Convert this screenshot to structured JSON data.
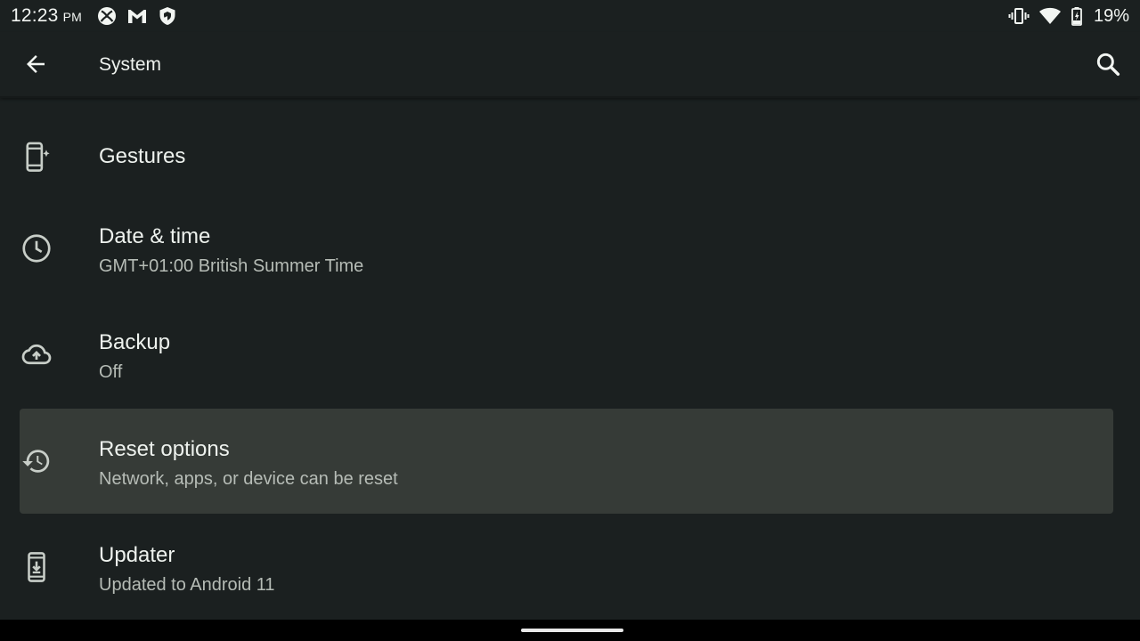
{
  "status_bar": {
    "time": "12:23",
    "ampm": "PM",
    "notification_icons": [
      "xbox-icon",
      "gmail-icon",
      "shield-icon"
    ],
    "system_icons": [
      "vibrate-icon",
      "wifi-icon",
      "battery-icon"
    ],
    "battery_percent": "19%"
  },
  "toolbar": {
    "title": "System",
    "back_icon": "arrow-back-icon",
    "search_icon": "search-icon"
  },
  "settings": {
    "items": [
      {
        "icon": "gestures-icon",
        "title": "Gestures",
        "subtitle": ""
      },
      {
        "icon": "clock-icon",
        "title": "Date & time",
        "subtitle": "GMT+01:00 British Summer Time"
      },
      {
        "icon": "cloud-upload-icon",
        "title": "Backup",
        "subtitle": "Off"
      },
      {
        "icon": "restore-icon",
        "title": "Reset options",
        "subtitle": "Network, apps, or device can be reset",
        "highlighted": true
      },
      {
        "icon": "system-update-icon",
        "title": "Updater",
        "subtitle": "Updated to Android 11"
      }
    ]
  },
  "colors": {
    "background": "#1b2020",
    "highlight": "#363b37",
    "text_primary": "#eef2ee",
    "text_secondary": "#b6bcb6",
    "icon": "#c8cec8"
  }
}
